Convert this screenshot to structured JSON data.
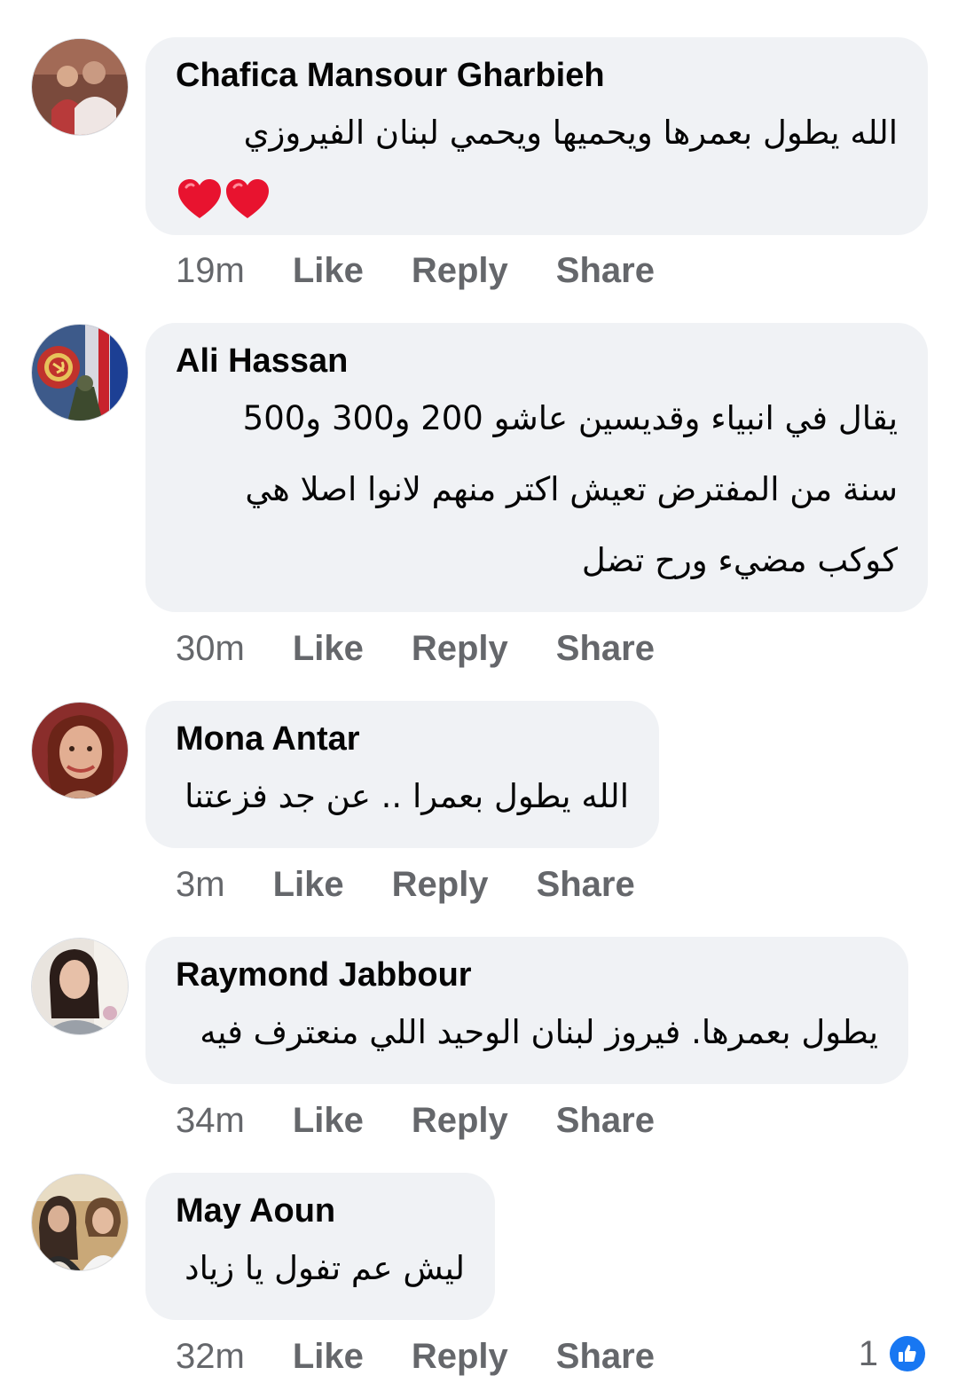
{
  "comments": [
    {
      "author": "Chafica Mansour Gharbieh",
      "text": "الله يطول بعمرها  ويحميها ويحمي لبنان الفيروزي",
      "emoji": "❤️❤️",
      "time": "19m",
      "actions": {
        "like": "Like",
        "reply": "Reply",
        "share": "Share"
      }
    },
    {
      "author": "Ali Hassan",
      "lines": [
        "يقال في انبياء وقديسين عاشو 200 و300 و500",
        "سنة من المفترض تعيش اكتر منهم لانوا اصلا هي",
        "كوكب مضيء ورح تضل"
      ],
      "time": "30m",
      "actions": {
        "like": "Like",
        "reply": "Reply",
        "share": "Share"
      }
    },
    {
      "author": "Mona Antar",
      "text": "الله يطول بعمرا .. عن جد فزعتنا",
      "time": "3m",
      "actions": {
        "like": "Like",
        "reply": "Reply",
        "share": "Share"
      }
    },
    {
      "author": "Raymond Jabbour",
      "text": "يطول بعمرها. فيروز لبنان الوحيد اللي منعترف فيه",
      "time": "34m",
      "actions": {
        "like": "Like",
        "reply": "Reply",
        "share": "Share"
      }
    },
    {
      "author": "May Aoun",
      "text": "ليش عم تفول يا زياد",
      "time": "32m",
      "actions": {
        "like": "Like",
        "reply": "Reply",
        "share": "Share"
      },
      "reaction_count": "1",
      "reaction_icon": "like-thumb-icon"
    }
  ],
  "colors": {
    "bubble": "#f0f2f5",
    "meta": "#65676b",
    "like_blue": "#1877f2",
    "heart_red": "#e8132f"
  }
}
